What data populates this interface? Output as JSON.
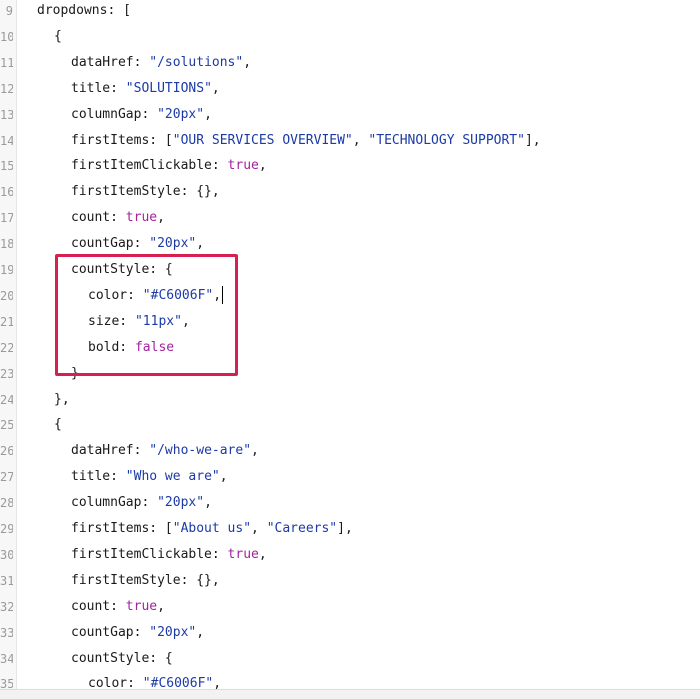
{
  "editor": {
    "lines": [
      {
        "n": "9",
        "text": "dropdowns: ["
      },
      {
        "n": "10",
        "text": "{"
      },
      {
        "n": "11",
        "key": "dataHref: ",
        "str": "\"/solutions\"",
        "tail": ","
      },
      {
        "n": "12",
        "key": "title: ",
        "str": "\"SOLUTIONS\"",
        "tail": ","
      },
      {
        "n": "13",
        "key": "columnGap: ",
        "str": "\"20px\"",
        "tail": ","
      },
      {
        "n": "14",
        "key": "firstItems: [",
        "str": "\"OUR SERVICES OVERVIEW\"",
        "mid": ", ",
        "str2": "\"TECHNOLOGY SUPPORT\"",
        "tail": "],"
      },
      {
        "n": "15",
        "key": "firstItemClickable: ",
        "bool": "true",
        "tail": ","
      },
      {
        "n": "16",
        "text": "firstItemStyle: {},"
      },
      {
        "n": "17",
        "key": "count: ",
        "bool": "true",
        "tail": ","
      },
      {
        "n": "18",
        "key": "countGap: ",
        "str": "\"20px\"",
        "tail": ","
      },
      {
        "n": "19",
        "text": "countStyle: {"
      },
      {
        "n": "20",
        "key": "color: ",
        "str": "\"#C6006F\"",
        "tail": ","
      },
      {
        "n": "21",
        "key": "size: ",
        "str": "\"11px\"",
        "tail": ","
      },
      {
        "n": "22",
        "key": "bold: ",
        "bool": "false"
      },
      {
        "n": "23",
        "text": "}"
      },
      {
        "n": "24",
        "text": "},"
      },
      {
        "n": "25",
        "text": "{"
      },
      {
        "n": "26",
        "key": "dataHref: ",
        "str": "\"/who-we-are\"",
        "tail": ","
      },
      {
        "n": "27",
        "key": "title: ",
        "str": "\"Who we are\"",
        "tail": ","
      },
      {
        "n": "28",
        "key": "columnGap: ",
        "str": "\"20px\"",
        "tail": ","
      },
      {
        "n": "29",
        "key": "firstItems: [",
        "str": "\"About us\"",
        "mid": ", ",
        "str2": "\"Careers\"",
        "tail": "],"
      },
      {
        "n": "30",
        "key": "firstItemClickable: ",
        "bool": "true",
        "tail": ","
      },
      {
        "n": "31",
        "text": "firstItemStyle: {},"
      },
      {
        "n": "32",
        "key": "count: ",
        "bool": "true",
        "tail": ","
      },
      {
        "n": "33",
        "key": "countGap: ",
        "str": "\"20px\"",
        "tail": ","
      },
      {
        "n": "34",
        "text": "countStyle: {"
      },
      {
        "n": "35",
        "key": "color: ",
        "str": "\"#C6006F\"",
        "tail": ","
      }
    ]
  },
  "colors": {
    "string": "#1c3aa6",
    "boolean": "#a3239e",
    "highlight_border": "#d6204f"
  }
}
